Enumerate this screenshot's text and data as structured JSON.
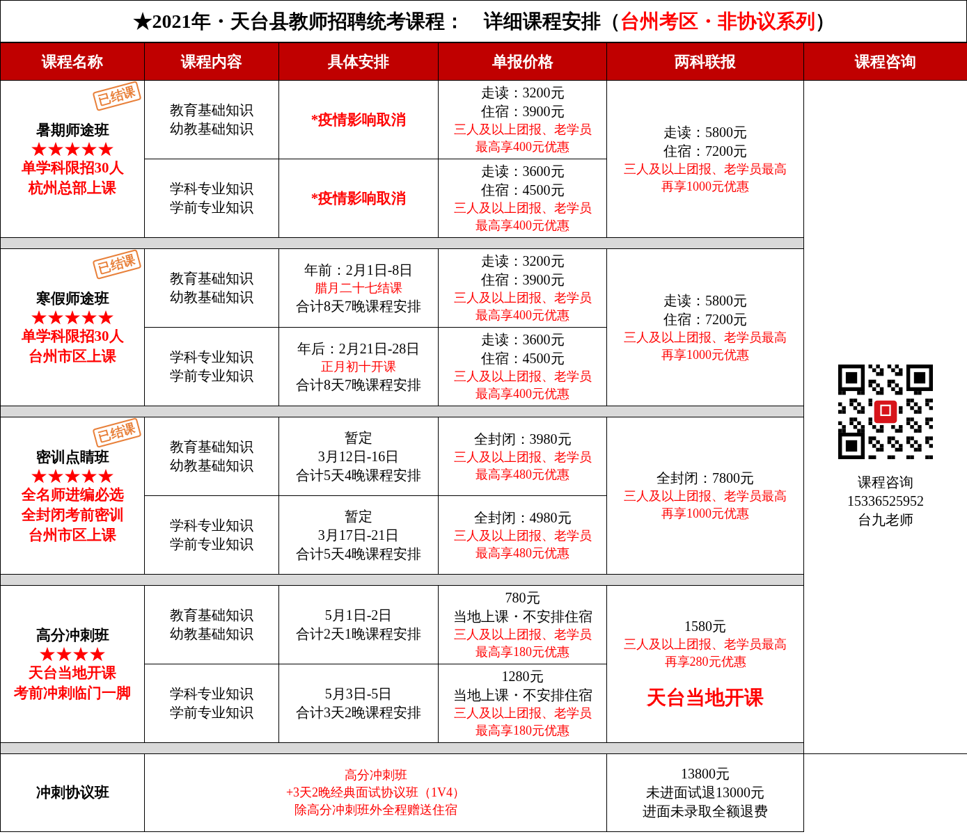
{
  "title": {
    "parts": [
      {
        "text": "★2021年・天台县教师招聘统考课程：　详细课程安排（",
        "kind": "black"
      },
      {
        "text": "台州考区・非协议系列",
        "kind": "red"
      },
      {
        "text": "）",
        "kind": "black"
      }
    ]
  },
  "headers": [
    "课程名称",
    "课程内容",
    "具体安排",
    "单报价格",
    "两科联报",
    "课程咨询"
  ],
  "courses": [
    {
      "name": "暑期师途班",
      "stars": 5,
      "notes": [
        "单学科限招30人",
        "杭州总部上课"
      ],
      "stamp": "已结课",
      "sessions": [
        {
          "subjects": [
            "教育基础知识",
            "幼教基础知识"
          ],
          "schedule": [
            {
              "text": "*疫情影响取消",
              "kind": "red-bold"
            }
          ],
          "price": [
            {
              "text": "走读：3200元",
              "kind": "black"
            },
            {
              "text": "住宿：3900元",
              "kind": "black"
            },
            {
              "text": "三人及以上团报、老学员",
              "kind": "red"
            },
            {
              "text": "最高享400元优惠",
              "kind": "red"
            }
          ]
        },
        {
          "subjects": [
            "学科专业知识",
            "学前专业知识"
          ],
          "schedule": [
            {
              "text": "*疫情影响取消",
              "kind": "red-bold"
            }
          ],
          "price": [
            {
              "text": "走读：3600元",
              "kind": "black"
            },
            {
              "text": "住宿：4500元",
              "kind": "black"
            },
            {
              "text": "三人及以上团报、老学员",
              "kind": "red"
            },
            {
              "text": "最高享400元优惠",
              "kind": "red"
            }
          ]
        }
      ],
      "combo": [
        {
          "text": "走读：5800元",
          "kind": "black"
        },
        {
          "text": "住宿：7200元",
          "kind": "black"
        },
        {
          "text": "三人及以上团报、老学员最高",
          "kind": "red"
        },
        {
          "text": "再享1000元优惠",
          "kind": "red"
        }
      ]
    },
    {
      "name": "寒假师途班",
      "stars": 5,
      "notes": [
        "单学科限招30人",
        "台州市区上课"
      ],
      "stamp": "已结课",
      "sessions": [
        {
          "subjects": [
            "教育基础知识",
            "幼教基础知识"
          ],
          "schedule": [
            {
              "text": "年前：2月1日-8日",
              "kind": "black"
            },
            {
              "text": "腊月二十七结课",
              "kind": "red"
            },
            {
              "text": "合计8天7晚课程安排",
              "kind": "black"
            }
          ],
          "price": [
            {
              "text": "走读：3200元",
              "kind": "black"
            },
            {
              "text": "住宿：3900元",
              "kind": "black"
            },
            {
              "text": "三人及以上团报、老学员",
              "kind": "red"
            },
            {
              "text": "最高享400元优惠",
              "kind": "red"
            }
          ]
        },
        {
          "subjects": [
            "学科专业知识",
            "学前专业知识"
          ],
          "schedule": [
            {
              "text": "年后：2月21日-28日",
              "kind": "black"
            },
            {
              "text": "正月初十开课",
              "kind": "red"
            },
            {
              "text": "合计8天7晚课程安排",
              "kind": "black"
            }
          ],
          "price": [
            {
              "text": "走读：3600元",
              "kind": "black"
            },
            {
              "text": "住宿：4500元",
              "kind": "black"
            },
            {
              "text": "三人及以上团报、老学员",
              "kind": "red"
            },
            {
              "text": "最高享400元优惠",
              "kind": "red"
            }
          ]
        }
      ],
      "combo": [
        {
          "text": "走读：5800元",
          "kind": "black"
        },
        {
          "text": "住宿：7200元",
          "kind": "black"
        },
        {
          "text": "三人及以上团报、老学员最高",
          "kind": "red"
        },
        {
          "text": "再享1000元优惠",
          "kind": "red"
        }
      ]
    },
    {
      "name": "密训点睛班",
      "stars": 5,
      "notes": [
        "全名师进编必选",
        "全封闭考前密训",
        "台州市区上课"
      ],
      "stamp": "已结课",
      "sessions": [
        {
          "subjects": [
            "教育基础知识",
            "幼教基础知识"
          ],
          "schedule": [
            {
              "text": "暂定",
              "kind": "black"
            },
            {
              "text": "3月12日-16日",
              "kind": "black"
            },
            {
              "text": "合计5天4晚课程安排",
              "kind": "black"
            }
          ],
          "price": [
            {
              "text": "全封闭：3980元",
              "kind": "black"
            },
            {
              "text": "三人及以上团报、老学员",
              "kind": "red"
            },
            {
              "text": "最高享480元优惠",
              "kind": "red"
            }
          ]
        },
        {
          "subjects": [
            "学科专业知识",
            "学前专业知识"
          ],
          "schedule": [
            {
              "text": "暂定",
              "kind": "black"
            },
            {
              "text": "3月17日-21日",
              "kind": "black"
            },
            {
              "text": "合计5天4晚课程安排",
              "kind": "black"
            }
          ],
          "price": [
            {
              "text": "全封闭：4980元",
              "kind": "black"
            },
            {
              "text": "三人及以上团报、老学员",
              "kind": "red"
            },
            {
              "text": "最高享480元优惠",
              "kind": "red"
            }
          ]
        }
      ],
      "combo": [
        {
          "text": "全封闭：7800元",
          "kind": "black"
        },
        {
          "text": "三人及以上团报、老学员最高",
          "kind": "red"
        },
        {
          "text": "再享1000元优惠",
          "kind": "red"
        }
      ]
    },
    {
      "name": "高分冲刺班",
      "stars": 4,
      "notes": [
        "天台当地开课",
        "考前冲刺临门一脚"
      ],
      "sessions": [
        {
          "subjects": [
            "教育基础知识",
            "幼教基础知识"
          ],
          "schedule": [
            {
              "text": "5月1日-2日",
              "kind": "black"
            },
            {
              "text": "合计2天1晚课程安排",
              "kind": "black"
            }
          ],
          "price": [
            {
              "text": "780元",
              "kind": "black"
            },
            {
              "text": "当地上课・不安排住宿",
              "kind": "black"
            },
            {
              "text": "三人及以上团报、老学员",
              "kind": "red"
            },
            {
              "text": "最高享180元优惠",
              "kind": "red"
            }
          ]
        },
        {
          "subjects": [
            "学科专业知识",
            "学前专业知识"
          ],
          "schedule": [
            {
              "text": "5月3日-5日",
              "kind": "black"
            },
            {
              "text": "合计3天2晚课程安排",
              "kind": "black"
            }
          ],
          "price": [
            {
              "text": "1280元",
              "kind": "black"
            },
            {
              "text": "当地上课・不安排住宿",
              "kind": "black"
            },
            {
              "text": "三人及以上团报、老学员",
              "kind": "red"
            },
            {
              "text": "最高享180元优惠",
              "kind": "red"
            }
          ]
        }
      ],
      "combo": [
        {
          "text": "1580元",
          "kind": "black"
        },
        {
          "text": "三人及以上团报、老学员最高",
          "kind": "red"
        },
        {
          "text": "再享280元优惠",
          "kind": "red"
        },
        {
          "text": "天台当地开课",
          "kind": "red-large"
        }
      ]
    }
  ],
  "agreement": {
    "name": "冲刺协议班",
    "content": [
      {
        "text": "高分冲刺班",
        "kind": "red"
      },
      {
        "text": "+3天2晚经典面试协议班（1V4）",
        "kind": "red"
      },
      {
        "text": "除高分冲刺班外全程赠送住宿",
        "kind": "red"
      }
    ],
    "price": [
      {
        "text": "13800元",
        "kind": "black"
      },
      {
        "text": "未进面试退13000元",
        "kind": "black"
      },
      {
        "text": "进面未录取全额退费",
        "kind": "black"
      }
    ]
  },
  "consult": {
    "lines": [
      "课程咨询",
      "15336525952",
      "台九老师"
    ]
  }
}
